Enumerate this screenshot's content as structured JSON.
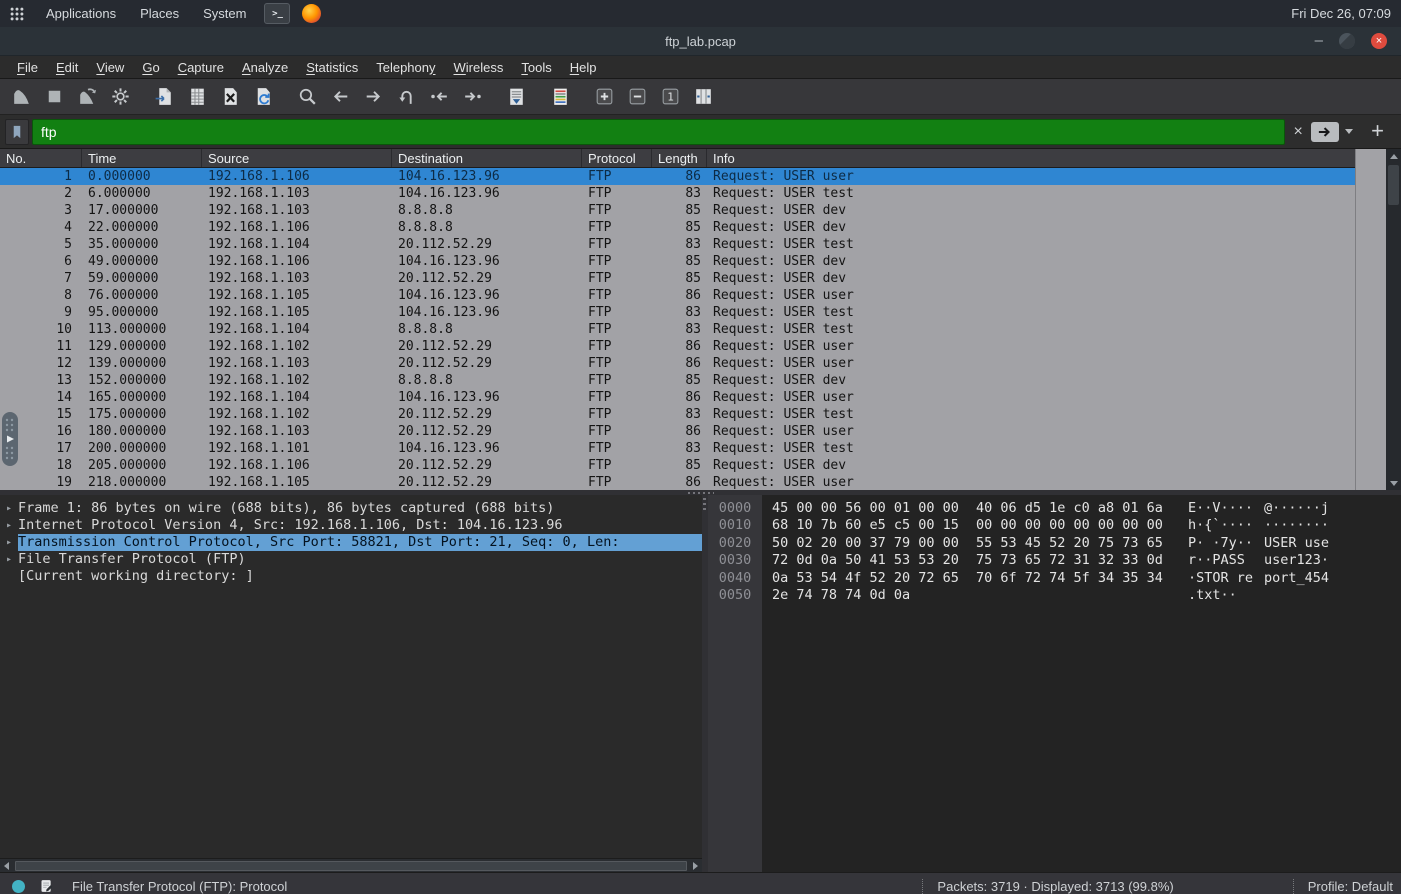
{
  "os_bar": {
    "applications_menu": "Applications",
    "places_menu": "Places",
    "system_menu": "System",
    "clock": "Fri Dec 26, 07:09"
  },
  "window": {
    "title": "ftp_lab.pcap",
    "controls": {
      "minimize": "–",
      "close": "×"
    }
  },
  "menu_bar": {
    "items": [
      {
        "label": "File",
        "u": 0
      },
      {
        "label": "Edit",
        "u": 0
      },
      {
        "label": "View",
        "u": 0
      },
      {
        "label": "Go",
        "u": 0
      },
      {
        "label": "Capture",
        "u": 0
      },
      {
        "label": "Analyze",
        "u": 0
      },
      {
        "label": "Statistics",
        "u": 0
      },
      {
        "label": "Telephony",
        "u": 8
      },
      {
        "label": "Wireless",
        "u": 0
      },
      {
        "label": "Tools",
        "u": 0
      },
      {
        "label": "Help",
        "u": 0
      }
    ]
  },
  "toolbar": {
    "icons": [
      "start-capture",
      "stop-capture",
      "restart-capture",
      "capture-options",
      "open-file",
      "save-file",
      "close-file",
      "reload-file",
      "find-packet",
      "go-back",
      "go-forward",
      "go-to-packet",
      "first-packet",
      "last-packet",
      "auto-scroll",
      "colorize",
      "zoom-in",
      "zoom-out",
      "zoom-original",
      "resize-columns"
    ]
  },
  "filter_bar": {
    "value": "ftp",
    "clear_label": "×",
    "add_label": "+"
  },
  "packet_list": {
    "columns": [
      "No.",
      "Time",
      "Source",
      "Destination",
      "Protocol",
      "Length",
      "Info"
    ],
    "rows": [
      {
        "no": "1",
        "time": "0.000000",
        "source": "192.168.1.106",
        "destination": "104.16.123.96",
        "protocol": "FTP",
        "length": "86",
        "info": "Request: USER user",
        "selected": true
      },
      {
        "no": "2",
        "time": "6.000000",
        "source": "192.168.1.103",
        "destination": "104.16.123.96",
        "protocol": "FTP",
        "length": "83",
        "info": "Request: USER test",
        "selected": false
      },
      {
        "no": "3",
        "time": "17.000000",
        "source": "192.168.1.103",
        "destination": "8.8.8.8",
        "protocol": "FTP",
        "length": "85",
        "info": "Request: USER dev",
        "selected": false
      },
      {
        "no": "4",
        "time": "22.000000",
        "source": "192.168.1.106",
        "destination": "8.8.8.8",
        "protocol": "FTP",
        "length": "85",
        "info": "Request: USER dev",
        "selected": false
      },
      {
        "no": "5",
        "time": "35.000000",
        "source": "192.168.1.104",
        "destination": "20.112.52.29",
        "protocol": "FTP",
        "length": "83",
        "info": "Request: USER test",
        "selected": false
      },
      {
        "no": "6",
        "time": "49.000000",
        "source": "192.168.1.106",
        "destination": "104.16.123.96",
        "protocol": "FTP",
        "length": "85",
        "info": "Request: USER dev",
        "selected": false
      },
      {
        "no": "7",
        "time": "59.000000",
        "source": "192.168.1.103",
        "destination": "20.112.52.29",
        "protocol": "FTP",
        "length": "85",
        "info": "Request: USER dev",
        "selected": false
      },
      {
        "no": "8",
        "time": "76.000000",
        "source": "192.168.1.105",
        "destination": "104.16.123.96",
        "protocol": "FTP",
        "length": "86",
        "info": "Request: USER user",
        "selected": false
      },
      {
        "no": "9",
        "time": "95.000000",
        "source": "192.168.1.105",
        "destination": "104.16.123.96",
        "protocol": "FTP",
        "length": "83",
        "info": "Request: USER test",
        "selected": false
      },
      {
        "no": "10",
        "time": "113.000000",
        "source": "192.168.1.104",
        "destination": "8.8.8.8",
        "protocol": "FTP",
        "length": "83",
        "info": "Request: USER test",
        "selected": false
      },
      {
        "no": "11",
        "time": "129.000000",
        "source": "192.168.1.102",
        "destination": "20.112.52.29",
        "protocol": "FTP",
        "length": "86",
        "info": "Request: USER user",
        "selected": false
      },
      {
        "no": "12",
        "time": "139.000000",
        "source": "192.168.1.103",
        "destination": "20.112.52.29",
        "protocol": "FTP",
        "length": "86",
        "info": "Request: USER user",
        "selected": false
      },
      {
        "no": "13",
        "time": "152.000000",
        "source": "192.168.1.102",
        "destination": "8.8.8.8",
        "protocol": "FTP",
        "length": "85",
        "info": "Request: USER dev",
        "selected": false
      },
      {
        "no": "14",
        "time": "165.000000",
        "source": "192.168.1.104",
        "destination": "104.16.123.96",
        "protocol": "FTP",
        "length": "86",
        "info": "Request: USER user",
        "selected": false
      },
      {
        "no": "15",
        "time": "175.000000",
        "source": "192.168.1.102",
        "destination": "20.112.52.29",
        "protocol": "FTP",
        "length": "83",
        "info": "Request: USER test",
        "selected": false
      },
      {
        "no": "16",
        "time": "180.000000",
        "source": "192.168.1.103",
        "destination": "20.112.52.29",
        "protocol": "FTP",
        "length": "86",
        "info": "Request: USER user",
        "selected": false
      },
      {
        "no": "17",
        "time": "200.000000",
        "source": "192.168.1.101",
        "destination": "104.16.123.96",
        "protocol": "FTP",
        "length": "83",
        "info": "Request: USER test",
        "selected": false
      },
      {
        "no": "18",
        "time": "205.000000",
        "source": "192.168.1.106",
        "destination": "20.112.52.29",
        "protocol": "FTP",
        "length": "85",
        "info": "Request: USER dev",
        "selected": false
      },
      {
        "no": "19",
        "time": "218.000000",
        "source": "192.168.1.105",
        "destination": "20.112.52.29",
        "protocol": "FTP",
        "length": "86",
        "info": "Request: USER user",
        "selected": false
      }
    ]
  },
  "details_pane": {
    "lines": [
      {
        "text": "Frame 1: 86 bytes on wire (688 bits), 86 bytes captured (688 bits)",
        "expander": true,
        "selected": false
      },
      {
        "text": "Internet Protocol Version 4, Src: 192.168.1.106, Dst: 104.16.123.96",
        "expander": true,
        "selected": false
      },
      {
        "text": "Transmission Control Protocol, Src Port: 58821, Dst Port: 21, Seq: 0, Len: ",
        "expander": true,
        "selected": true
      },
      {
        "text": "File Transfer Protocol (FTP)",
        "expander": true,
        "selected": false
      },
      {
        "text": "[Current working directory: ]",
        "expander": false,
        "selected": false
      }
    ]
  },
  "hex_pane": {
    "rows": [
      {
        "offset": "0000",
        "hex_left": "45 00 00 56 00 01 00 00",
        "hex_right": "40 06 d5 1e c0 a8 01 6a",
        "ascii_left": "E··V····",
        "ascii_right": "@······j"
      },
      {
        "offset": "0010",
        "hex_left": "68 10 7b 60 e5 c5 00 15",
        "hex_right": "00 00 00 00 00 00 00 00",
        "ascii_left": "h·{`····",
        "ascii_right": "········"
      },
      {
        "offset": "0020",
        "hex_left": "50 02 20 00 37 79 00 00",
        "hex_right": "55 53 45 52 20 75 73 65",
        "ascii_left": "P· ·7y··",
        "ascii_right": "USER use"
      },
      {
        "offset": "0030",
        "hex_left": "72 0d 0a 50 41 53 53 20",
        "hex_right": "75 73 65 72 31 32 33 0d",
        "ascii_left": "r··PASS ",
        "ascii_right": "user123·"
      },
      {
        "offset": "0040",
        "hex_left": "0a 53 54 4f 52 20 72 65",
        "hex_right": "70 6f 72 74 5f 34 35 34",
        "ascii_left": "·STOR re",
        "ascii_right": "port_454"
      },
      {
        "offset": "0050",
        "hex_left": "2e 74 78 74 0d 0a",
        "hex_right": "",
        "ascii_left": ".txt··",
        "ascii_right": ""
      }
    ]
  },
  "status_bar": {
    "field_info": "File Transfer Protocol (FTP): Protocol",
    "packets_info": "Packets: 3719 · Displayed: 3713 (99.8%)",
    "profile": "Profile: Default"
  },
  "colors": {
    "selected_row": "#2f86d2",
    "filter_bg": "#128012",
    "detail_highlight": "#63a0d4",
    "close_button": "#df4b3e",
    "expert_info": "#43b3c4"
  }
}
